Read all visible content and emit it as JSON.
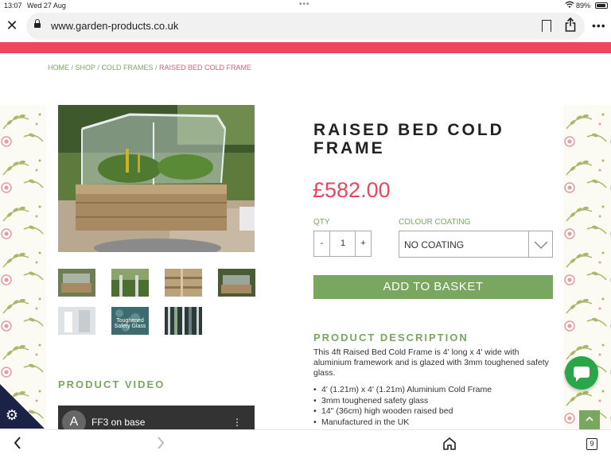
{
  "status_bar": {
    "time": "13:07",
    "date": "Wed 27 Aug",
    "battery_pct": "89%"
  },
  "browser": {
    "url": "www.garden-products.co.uk",
    "tab_count": "9"
  },
  "breadcrumb": {
    "items": [
      "HOME",
      "SHOP",
      "COLD FRAMES"
    ],
    "current": "RAISED BED COLD FRAME",
    "separator": "/"
  },
  "product": {
    "title": "RAISED BED COLD FRAME",
    "price": "£582.00",
    "qty_label": "QTY",
    "qty_minus": "-",
    "qty_value": "1",
    "qty_plus": "+",
    "colour_label": "COLOUR COATING",
    "colour_value": "NO COATING",
    "add_to_basket": "ADD TO BASKET",
    "thumb_caption": "Toughened Safety Glass"
  },
  "description": {
    "heading": "PRODUCT DESCRIPTION",
    "text": "This 4ft Raised Bed Cold Frame is 4' long x 4' wide with aluminium framework and is glazed with 3mm toughened safety glass.",
    "bullets": [
      "4' (1.21m) x 4' (1.21m) Aluminium Cold Frame",
      "3mm toughened safety glass",
      "14\" (36cm) high wooden raised bed",
      "Manufactured in the UK"
    ]
  },
  "video": {
    "heading": "PRODUCT VIDEO",
    "avatar_letter": "A",
    "title": "FF3 on base"
  },
  "colors": {
    "accent_green": "#7aa75f",
    "accent_pink": "#f0475e",
    "price_red": "#e8465e",
    "chat_green": "#2aa64a"
  }
}
